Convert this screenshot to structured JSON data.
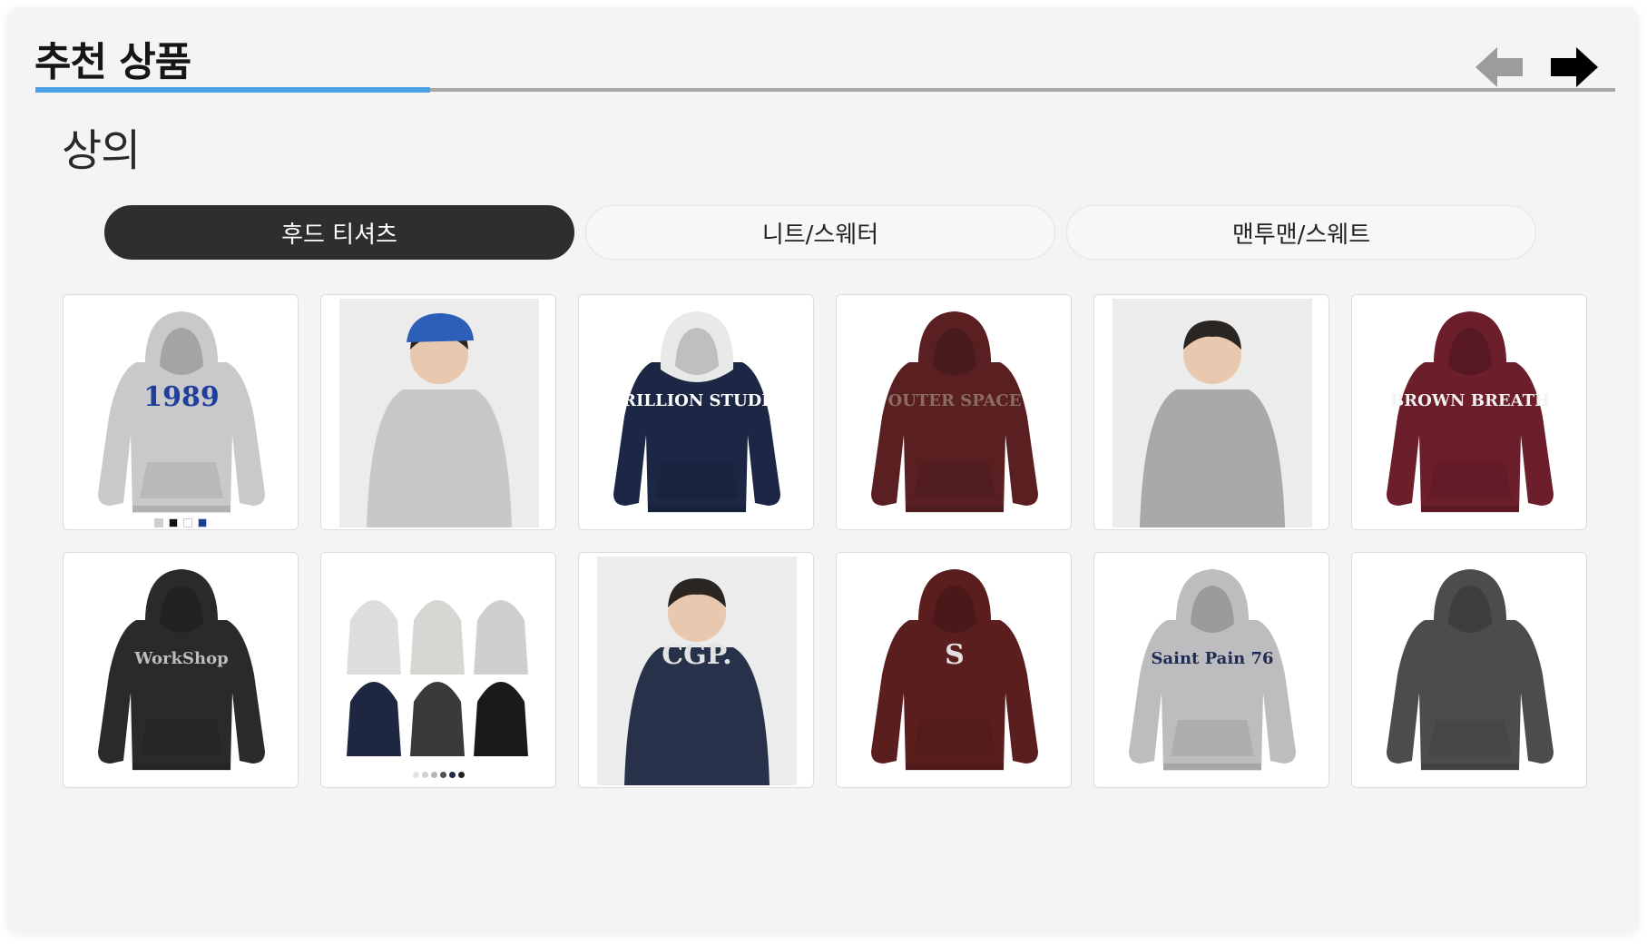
{
  "section_title": "추천 상품",
  "nav": {
    "prev_icon": "arrow-left-icon",
    "next_icon": "arrow-right-icon"
  },
  "progress": {
    "fraction": 0.25,
    "fill_color": "#4aa1e8",
    "track_color": "#a8a8a8"
  },
  "category_title": "상의",
  "tabs": [
    {
      "label": "후드 티셔츠",
      "active": true
    },
    {
      "label": "니트/스웨터",
      "active": false
    },
    {
      "label": "맨투맨/스웨트",
      "active": false
    }
  ],
  "products": [
    {
      "color": "#c9c9cb",
      "print": "1989",
      "print_color": "#1f3f9a",
      "swatches": [
        "#cfcfcf",
        "#111111",
        "#ffffff",
        "#163f97"
      ]
    },
    {
      "color": "#c8c8c8",
      "model_photo": true,
      "cap_color": "#2d5fb8"
    },
    {
      "color": "#1b2744",
      "hood_color": "#e9e9e9",
      "print": "TRILLION STUDIO",
      "print_color": "#ffffff"
    },
    {
      "color": "#5a2021",
      "print": "OUTER SPACE",
      "print_color": "#8a6c64"
    },
    {
      "color": "#a9a9ab",
      "model_photo": true
    },
    {
      "color": "#6c1e2b",
      "print": "BROWN BREATH",
      "print_color": "#f2f2f2"
    },
    {
      "color": "#2a2a2a",
      "print": "WorkShop",
      "print_color": "#bdbdbd"
    },
    {
      "color": "#cfcfcf",
      "multi": true,
      "dots": [
        "#e2e2e2",
        "#d0d0d0",
        "#b5b5b5",
        "#505050",
        "#1e2742",
        "#222222"
      ]
    },
    {
      "color": "#27324a",
      "model_photo": true,
      "print": "CGP.",
      "print_color": "#e3e3e3"
    },
    {
      "color": "#5b1e1e",
      "print": "S",
      "print_color": "#e6dede"
    },
    {
      "color": "#bdbdbf",
      "print": "Saint Pain 76",
      "print_color": "#1f2b55"
    },
    {
      "color": "#4c4c4e",
      "print": "",
      "print_color": "#3a3a3a"
    }
  ]
}
